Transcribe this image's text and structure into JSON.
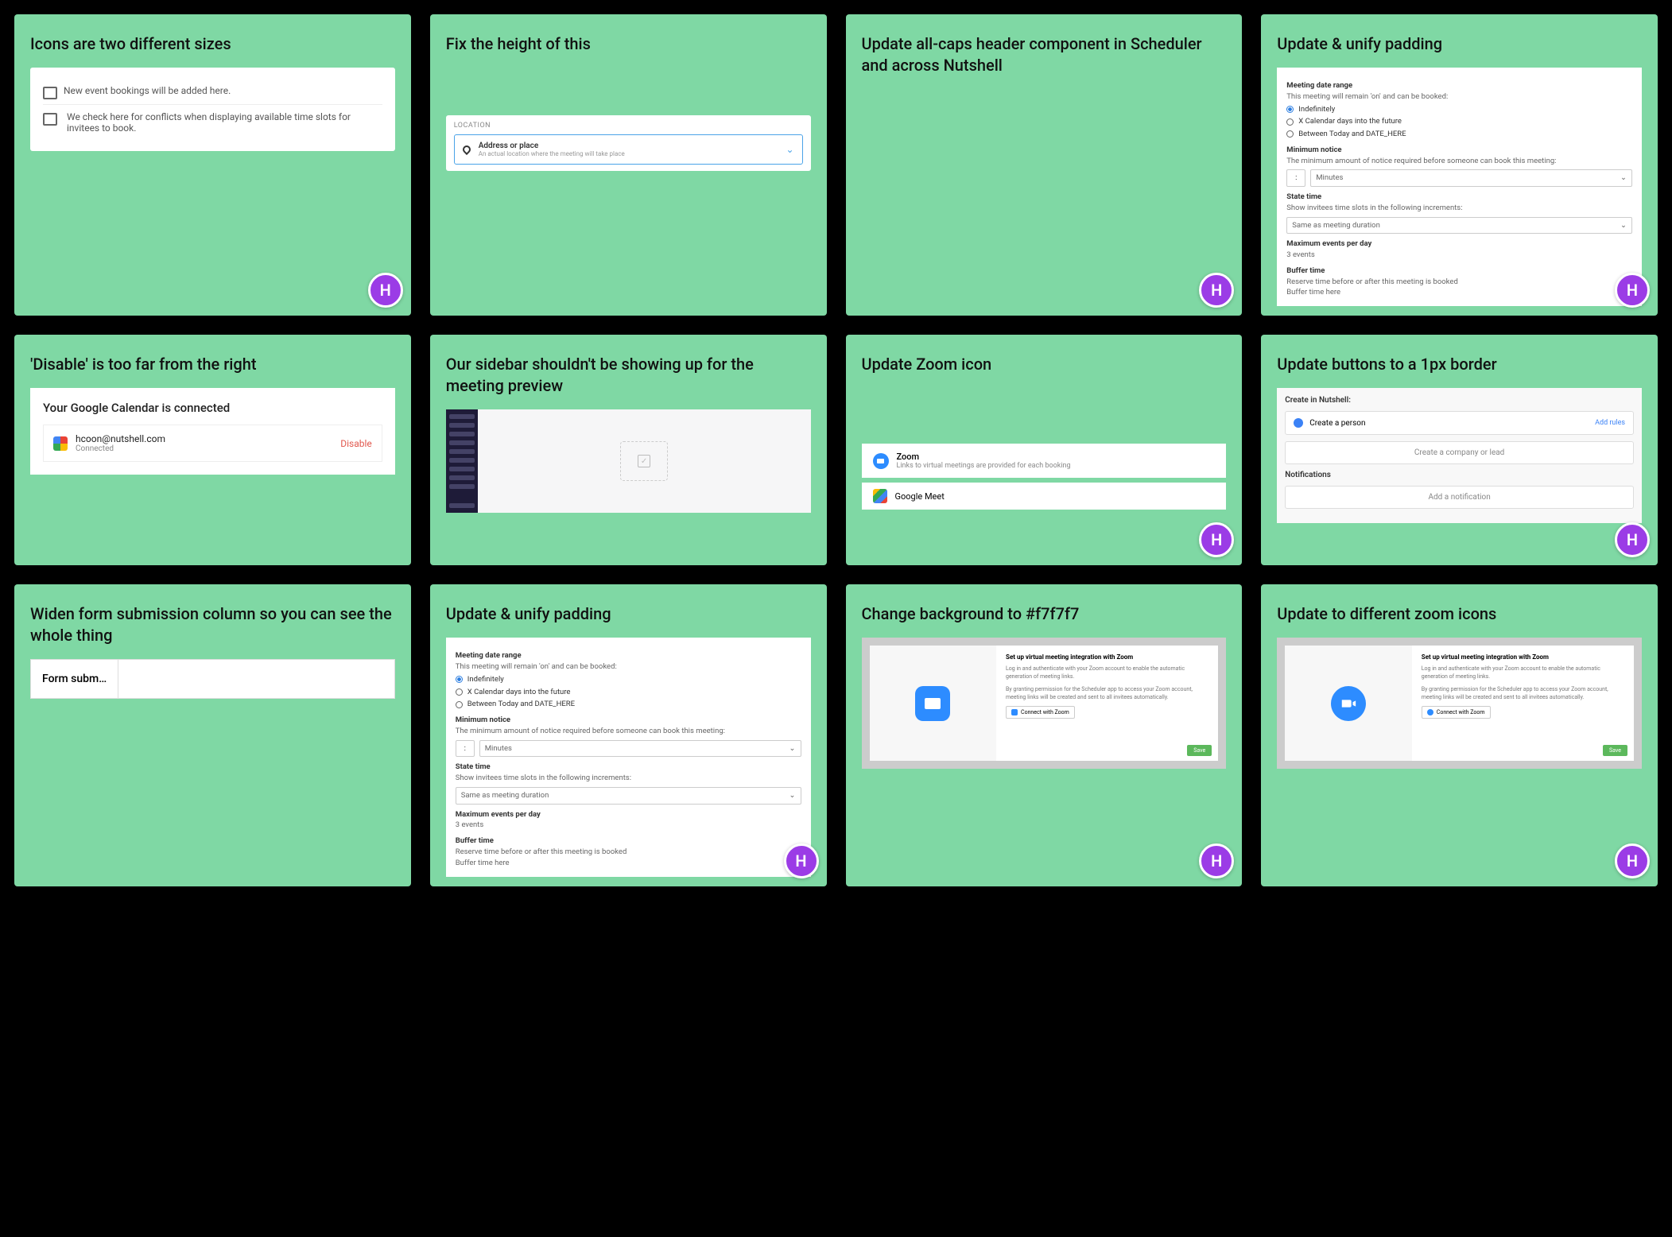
{
  "avatar_initial": "H",
  "cards": [
    {
      "title": "Icons are two different sizes",
      "has_avatar": true,
      "panel": {
        "row1": "New event bookings will be added here.",
        "row2": "We check here for conflicts when displaying available time slots for invitees to book."
      }
    },
    {
      "title": "Fix the height of this",
      "has_avatar": false,
      "loc": {
        "label": "LOCATION",
        "heading": "Address or place",
        "sub": "An actual location where the meeting will take place"
      }
    },
    {
      "title": "Update all-caps header component in Scheduler and across Nutshell",
      "has_avatar": true
    },
    {
      "title": "Update & unify padding",
      "has_avatar": true,
      "form": {
        "h1": "Meeting date range",
        "sub1": "This meeting will remain 'on' and can be booked:",
        "opt1": "Indefinitely",
        "opt2": "X Calendar days into the future",
        "opt3": "Between Today and DATE_HERE",
        "h2": "Minimum notice",
        "sub2": "The minimum amount of notice required before someone can book this meeting:",
        "num1": ":",
        "sel1": "Minutes",
        "h3": "State time",
        "sub3": "Show invitees time slots in the following increments:",
        "sel2": "Same as meeting duration",
        "h4": "Maximum events per day",
        "val4": "3 events",
        "h5": "Buffer time",
        "sub5": "Reserve time before or after this meeting is booked",
        "val5": "Buffer time here"
      }
    },
    {
      "title": "'Disable' is too far from the right",
      "has_avatar": false,
      "gcal": {
        "heading": "Your Google Calendar is connected",
        "email": "hcoon@nutshell.com",
        "status": "Connected",
        "action": "Disable"
      }
    },
    {
      "title": "Our sidebar shouldn't be showing up for the meeting preview",
      "has_avatar": false
    },
    {
      "title": "Update Zoom icon",
      "has_avatar": true,
      "zoom": {
        "name": "Zoom",
        "sub": "Links to virtual meetings are provided for each booking",
        "name2": "Google Meet"
      }
    },
    {
      "title": "Update buttons to a 1px border",
      "has_avatar": true,
      "ns": {
        "h1": "Create in Nutshell:",
        "b1": "Create a person",
        "link1": "Add rules",
        "b2": "Create a company or lead",
        "h2": "Notifications",
        "b3": "Add a notification"
      }
    },
    {
      "title": "Widen form submission column so you can see the whole thing",
      "has_avatar": false,
      "cell": "Form subm…"
    },
    {
      "title": "Update & unify padding",
      "has_avatar": true,
      "form": {
        "h1": "Meeting date range",
        "sub1": "This meeting will remain 'on' and can be booked:",
        "opt1": "Indefinitely",
        "opt2": "X Calendar days into the future",
        "opt3": "Between Today and DATE_HERE",
        "h2": "Minimum notice",
        "sub2": "The minimum amount of notice required before someone can book this meeting:",
        "num1": ":",
        "sel1": "Minutes",
        "h3": "State time",
        "sub3": "Show invitees time slots in the following increments:",
        "sel2": "Same as meeting duration",
        "h4": "Maximum events per day",
        "val4": "3 events",
        "h5": "Buffer time",
        "sub5": "Reserve time before or after this meeting is booked",
        "val5": "Buffer time here"
      }
    },
    {
      "title": "Change background to #f7f7f7",
      "has_avatar": true,
      "modal": {
        "title": "Set up virtual meeting integration with Zoom",
        "p1": "Log in and authenticate with your Zoom account to enable the automatic generation of meeting links.",
        "p2": "By granting permission for the Scheduler app to access your Zoom account, meeting links will be created and sent to all invitees automatically.",
        "btn": "Connect with Zoom",
        "save": "Save"
      }
    },
    {
      "title": "Update to different zoom icons",
      "has_avatar": true,
      "modal": {
        "title": "Set up virtual meeting integration with Zoom",
        "p1": "Log in and authenticate with your Zoom account to enable the automatic generation of meeting links.",
        "p2": "By granting permission for the Scheduler app to access your Zoom account, meeting links will be created and sent to all invitees automatically.",
        "btn": "Connect with Zoom",
        "save": "Save"
      }
    }
  ]
}
